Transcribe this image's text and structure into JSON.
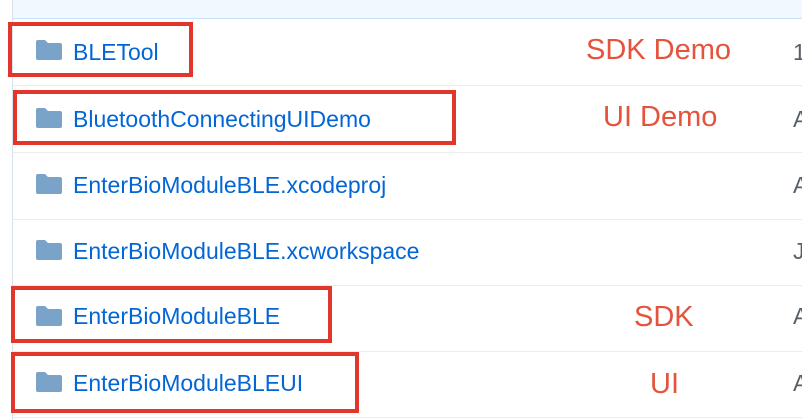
{
  "colors": {
    "link": "#0366d6",
    "annotation": "#e5533d",
    "highlight": "#e2352b",
    "folder": "#79a3c8"
  },
  "rows": [
    {
      "name": "BLETool",
      "icon": "folder-icon",
      "annotation": "SDK Demo",
      "trail": "1"
    },
    {
      "name": "BluetoothConnectingUIDemo",
      "icon": "folder-icon",
      "annotation": "UI Demo",
      "trail": "A"
    },
    {
      "name": "EnterBioModuleBLE.xcodeproj",
      "icon": "folder-icon",
      "annotation": "",
      "trail": "A"
    },
    {
      "name": "EnterBioModuleBLE.xcworkspace",
      "icon": "folder-icon",
      "annotation": "",
      "trail": "J"
    },
    {
      "name": "EnterBioModuleBLE",
      "icon": "folder-icon",
      "annotation": "SDK",
      "trail": "A"
    },
    {
      "name": "EnterBioModuleBLEUI",
      "icon": "folder-icon",
      "annotation": "UI",
      "trail": "A"
    }
  ]
}
